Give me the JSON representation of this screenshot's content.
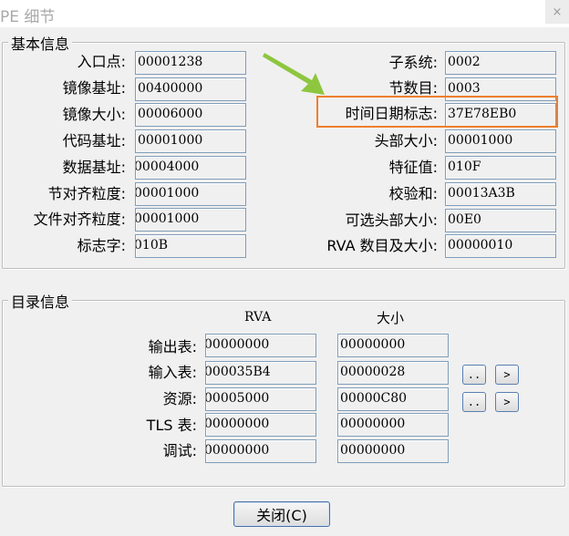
{
  "window": {
    "title": "PE 细节",
    "close_glyph": "×"
  },
  "basic": {
    "legend": "基本信息",
    "left": [
      {
        "label": "入口点:",
        "value": "00001238"
      },
      {
        "label": "镜像基址:",
        "value": "00400000"
      },
      {
        "label": "镜像大小:",
        "value": "00006000"
      },
      {
        "label": "代码基址:",
        "value": "00001000"
      },
      {
        "label": "数据基址:",
        "value": "00004000"
      },
      {
        "label": "节对齐粒度:",
        "value": "00001000"
      },
      {
        "label": "文件对齐粒度:",
        "value": "00001000"
      },
      {
        "label": "标志字:",
        "value": "010B"
      }
    ],
    "right": [
      {
        "label": "子系统:",
        "value": "0002"
      },
      {
        "label": "节数目:",
        "value": "0003"
      },
      {
        "label": "时间日期标志:",
        "value": "37E78EB0"
      },
      {
        "label": "头部大小:",
        "value": "00001000"
      },
      {
        "label": "特征值:",
        "value": "010F"
      },
      {
        "label": "校验和:",
        "value": "00013A3B"
      },
      {
        "label": "可选头部大小:",
        "value": "00E0"
      },
      {
        "label": "RVA 数目及大小:",
        "value": "00000010"
      }
    ]
  },
  "directory": {
    "legend": "目录信息",
    "col_rva": "RVA",
    "col_size": "大小",
    "rows": [
      {
        "label": "输出表:",
        "rva": "00000000",
        "size": "00000000"
      },
      {
        "label": "输入表:",
        "rva": "000035B4",
        "size": "00000028"
      },
      {
        "label": "资源:",
        "rva": "00005000",
        "size": "00000C80"
      },
      {
        "label": "TLS 表:",
        "rva": "00000000",
        "size": "00000000"
      },
      {
        "label": "调试:",
        "rva": "00000000",
        "size": "00000000"
      }
    ],
    "more_label": "..",
    "go_label": ">"
  },
  "footer": {
    "close_label": "关闭(C)"
  },
  "annotation": {
    "arrow_color": "#8dc63f",
    "highlight_color": "#ee7f2c"
  }
}
